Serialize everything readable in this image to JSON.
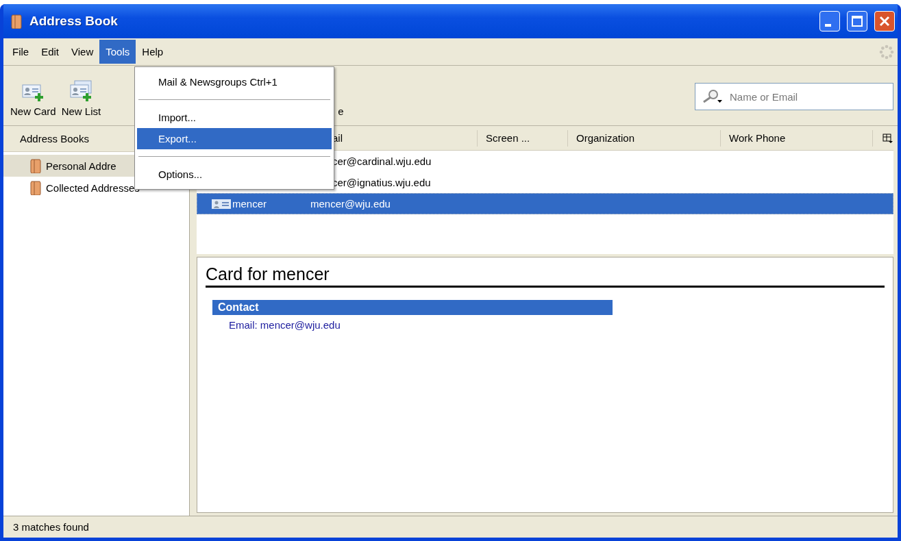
{
  "window": {
    "title": "Address Book"
  },
  "menu_bar": [
    {
      "label": "File",
      "selected": false
    },
    {
      "label": "Edit",
      "selected": false
    },
    {
      "label": "View",
      "selected": false
    },
    {
      "label": "Tools",
      "selected": true
    },
    {
      "label": "Help",
      "selected": false
    }
  ],
  "toolbar": [
    {
      "label": "New Card",
      "kind": "card"
    },
    {
      "label": "New List",
      "kind": "list"
    },
    {
      "label": "e",
      "kind": "hidden"
    }
  ],
  "search": {
    "placeholder": "Name or Email"
  },
  "sidebar": {
    "header": "Address Books",
    "items": [
      {
        "label": "Personal Addre",
        "selected": true
      },
      {
        "label": "Collected Addresses",
        "selected": false
      }
    ]
  },
  "table": {
    "columns": [
      "ail",
      "Screen ...",
      "Organization",
      "Work Phone"
    ],
    "rows": [
      {
        "email": "cer@cardinal.wju.edu",
        "selected": false
      },
      {
        "email": "cer@ignatius.wju.edu",
        "selected": false
      },
      {
        "name": "mencer",
        "email": "mencer@wju.edu",
        "selected": true
      }
    ]
  },
  "card": {
    "title": "Card for mencer",
    "section": "Contact",
    "lines": [
      "Email: mencer@wju.edu"
    ]
  },
  "tools_menu": {
    "items": [
      {
        "kind": "item",
        "label": "Mail & Newsgroups Ctrl+1",
        "selected": false
      },
      {
        "kind": "separator"
      },
      {
        "kind": "item",
        "label": "Import...",
        "selected": false
      },
      {
        "kind": "item",
        "label": "Export...",
        "selected": true
      },
      {
        "kind": "separator"
      },
      {
        "kind": "item",
        "label": "Options...",
        "selected": false
      }
    ]
  },
  "status_bar": {
    "text": "3 matches found"
  }
}
